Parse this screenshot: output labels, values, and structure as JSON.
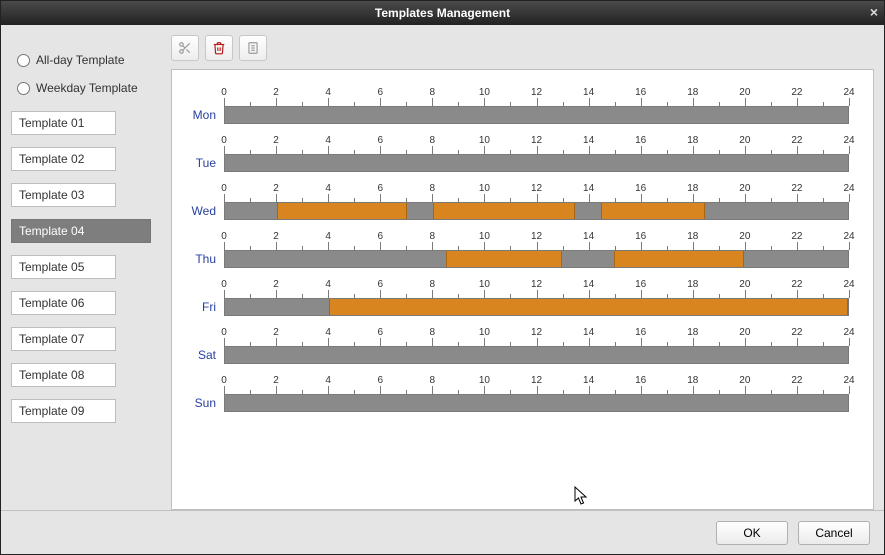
{
  "window": {
    "title": "Templates Management"
  },
  "sidebar": {
    "radios": [
      {
        "name": "allday",
        "label": "All-day Template",
        "checked": false
      },
      {
        "name": "weekday",
        "label": "Weekday Template",
        "checked": false
      }
    ],
    "templates": [
      {
        "label": "Template 01",
        "selected": false
      },
      {
        "label": "Template 02",
        "selected": false
      },
      {
        "label": "Template 03",
        "selected": false
      },
      {
        "label": "Template 04",
        "selected": true
      },
      {
        "label": "Template 05",
        "selected": false
      },
      {
        "label": "Template 06",
        "selected": false
      },
      {
        "label": "Template 07",
        "selected": false
      },
      {
        "label": "Template 08",
        "selected": false
      },
      {
        "label": "Template 09",
        "selected": false
      }
    ]
  },
  "toolbar": {
    "buttons": [
      {
        "name": "scissors-icon",
        "enabled": false
      },
      {
        "name": "delete-icon",
        "enabled": true
      },
      {
        "name": "clear-icon",
        "enabled": false
      }
    ]
  },
  "schedule": {
    "hours_axis": {
      "min": 0,
      "max": 24,
      "major_step": 2,
      "minor_step": 1
    },
    "days": [
      {
        "key": "mon",
        "label": "Mon",
        "segments": []
      },
      {
        "key": "tue",
        "label": "Tue",
        "segments": []
      },
      {
        "key": "wed",
        "label": "Wed",
        "segments": [
          {
            "start": 2,
            "end": 7
          },
          {
            "start": 8,
            "end": 13.5
          },
          {
            "start": 14.5,
            "end": 18.5
          }
        ]
      },
      {
        "key": "thu",
        "label": "Thu",
        "segments": [
          {
            "start": 8.5,
            "end": 13
          },
          {
            "start": 15,
            "end": 20
          }
        ]
      },
      {
        "key": "fri",
        "label": "Fri",
        "segments": [
          {
            "start": 4,
            "end": 24
          }
        ]
      },
      {
        "key": "sat",
        "label": "Sat",
        "segments": []
      },
      {
        "key": "sun",
        "label": "Sun",
        "segments": []
      }
    ]
  },
  "footer": {
    "ok_label": "OK",
    "cancel_label": "Cancel"
  }
}
